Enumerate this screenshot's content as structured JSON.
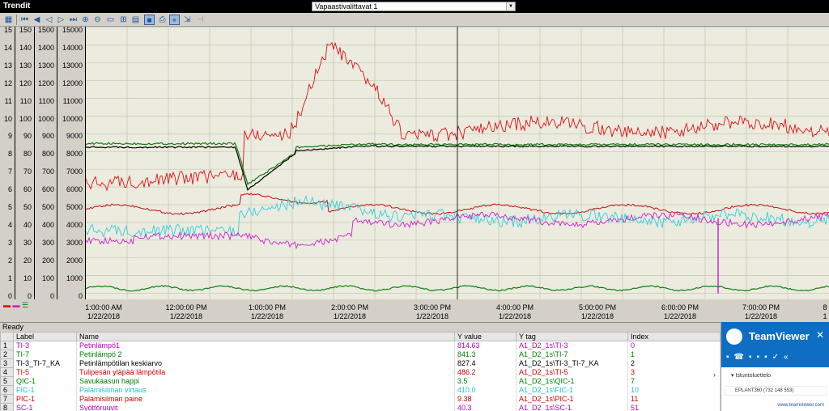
{
  "window": {
    "title": "Trendit",
    "preset": "Vapaastivalittavat 1"
  },
  "toolbar": {
    "icons": [
      "layout-icon",
      "first-icon",
      "prev-page-icon",
      "prev-icon",
      "next-icon",
      "last-icon",
      "zoom-in-icon",
      "zoom-out-icon",
      "window-icon",
      "grid-icon",
      "data-icon",
      "history-icon",
      "live-icon",
      "print-icon",
      "cursor-icon",
      "export-icon",
      "stop-icon"
    ]
  },
  "axes": [
    {
      "ticks": [
        "15",
        "14",
        "13",
        "12",
        "11",
        "10",
        "9",
        "8",
        "7",
        "6",
        "5",
        "4",
        "3",
        "2",
        "1",
        "0"
      ]
    },
    {
      "ticks": [
        "150",
        "140",
        "130",
        "120",
        "110",
        "100",
        "90",
        "80",
        "70",
        "60",
        "50",
        "40",
        "30",
        "20",
        "10",
        "0"
      ]
    },
    {
      "ticks": [
        "1500",
        "1400",
        "1300",
        "1200",
        "1100",
        "1000",
        "900",
        "800",
        "700",
        "600",
        "500",
        "400",
        "300",
        "200",
        "100",
        "0"
      ]
    },
    {
      "ticks": [
        "15000",
        "14000",
        "13000",
        "12000",
        "11000",
        "10000",
        "9000",
        "8000",
        "7000",
        "6000",
        "5000",
        "4000",
        "3000",
        "2000",
        "1000",
        "0"
      ]
    }
  ],
  "xaxis": [
    {
      "time": "1:00:00 AM",
      "date": "1/22/2018"
    },
    {
      "time": "12:00:00 PM",
      "date": "1/22/2018"
    },
    {
      "time": "1:00:00 PM",
      "date": "1/22/2018"
    },
    {
      "time": "2:00:00 PM",
      "date": "1/22/2018"
    },
    {
      "time": "3:00:00 PM",
      "date": "1/22/2018"
    },
    {
      "time": "4:00:00 PM",
      "date": "1/22/2018"
    },
    {
      "time": "5:00:00 PM",
      "date": "1/22/2018"
    },
    {
      "time": "6:00:00 PM",
      "date": "1/22/2018"
    },
    {
      "time": "7:00:00 PM",
      "date": "1/22/2018"
    },
    {
      "time": "8",
      "date": "1"
    }
  ],
  "status": "Ready",
  "table": {
    "headers": [
      "",
      "Label",
      "Name",
      "Y value",
      "Y tag",
      "Index"
    ],
    "rows": [
      {
        "n": "1",
        "label": "TI-3",
        "name": "Petinlämpö1",
        "y": "814.63",
        "tag": "A1_D2_1s\\TI-3",
        "idx": "0",
        "color": "#c000c0"
      },
      {
        "n": "2",
        "label": "TI-7",
        "name": "Petinlämpö 2",
        "y": "841.3",
        "tag": "A1_D2_1s\\TI-7",
        "idx": "1",
        "color": "#008000"
      },
      {
        "n": "3",
        "label": "TI-3_TI-7_KA",
        "name": "Petinlämpötilan keskiarvo",
        "y": "827.4",
        "tag": "A1_D2_1s\\TI-3_TI-7_KA",
        "idx": "2",
        "color": "#000000"
      },
      {
        "n": "4",
        "label": "TI-5",
        "name": "Tulipesän yläpää lämpötila",
        "y": "486.2",
        "tag": "A1_D2_1s\\TI-5",
        "idx": "3",
        "color": "#d00000"
      },
      {
        "n": "5",
        "label": "QIC-1",
        "name": "Savukaasun happi",
        "y": "3.5",
        "tag": "A1_D2_1s\\QIC-1",
        "idx": "7",
        "color": "#008000"
      },
      {
        "n": "6",
        "label": "FIC-1",
        "name": "Palamisilman virtaus",
        "y": "410.0",
        "tag": "A1_D2_1s\\FIC-1",
        "idx": "10",
        "color": "#20c0d0"
      },
      {
        "n": "7",
        "label": "PIC-1",
        "name": "Palamisilman paine",
        "y": "9.38",
        "tag": "A1_D2_1s\\PIC-1",
        "idx": "11",
        "color": "#d00000"
      },
      {
        "n": "8",
        "label": "SC-1",
        "name": "Syöttöruuvit",
        "y": "40.3",
        "tag": "A1_D2_1s\\SC-1",
        "idx": "51",
        "color": "#c000c0"
      }
    ]
  },
  "teamviewer": {
    "title": "TeamViewer",
    "sessions": "Istuntoluettelo",
    "partner": "EPLANT360 (732 148 553)",
    "link": "www.teamviewer.com"
  },
  "colors": {
    "red": "#e01010",
    "green": "#108010",
    "black": "#000000",
    "cyan": "#30d0e0",
    "magenta": "#d020d0",
    "plotbg": "#ebebdf"
  }
}
